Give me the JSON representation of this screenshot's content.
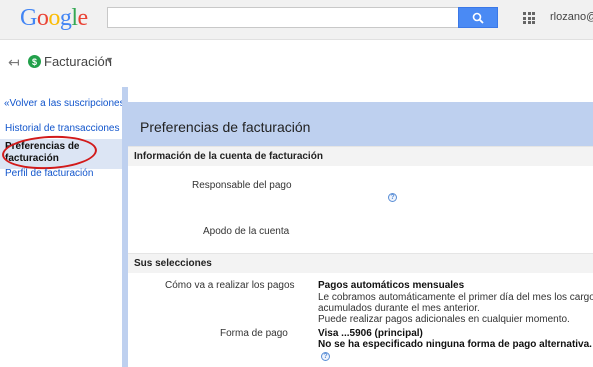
{
  "topbar": {
    "logo_letters": [
      {
        "char": "G",
        "color": "#4285f4"
      },
      {
        "char": "o",
        "color": "#ea4335"
      },
      {
        "char": "o",
        "color": "#fbbc05"
      },
      {
        "char": "g",
        "color": "#4285f4"
      },
      {
        "char": "l",
        "color": "#34a853"
      },
      {
        "char": "e",
        "color": "#ea4335"
      }
    ],
    "search_value": "",
    "user_text": "rlozano@v"
  },
  "subheader": {
    "product_name": "Facturación"
  },
  "sidebar": {
    "back_link": "«Volver a las suscripciones",
    "items": [
      {
        "label": "Historial de transacciones"
      },
      {
        "label": "Preferencias de facturación"
      },
      {
        "label": "Perfil de facturación"
      }
    ]
  },
  "main": {
    "title": "Preferencias de facturación",
    "account_section": {
      "title": "Información de la cuenta de facturación",
      "responsible_label": "Responsable del pago",
      "alias_label": "Apodo de la cuenta"
    },
    "selections_section": {
      "title": "Sus selecciones",
      "payment_method_label": "Cómo va a realizar los pagos",
      "payment_method_value": "Pagos automáticos mensuales",
      "payment_method_desc_1": "Le cobramos automáticamente el primer día del mes los cargos",
      "payment_method_desc_2": "acumulados durante el mes anterior.",
      "payment_method_desc_3": "Puede realizar pagos adicionales en cualquier momento.",
      "payment_form_label": "Forma de pago",
      "payment_form_value": "Visa ...5906 (principal)",
      "payment_form_note": "No se ha especificado ninguna forma de pago alternativa."
    }
  },
  "colors": {
    "accent_band": "#bed0ef",
    "link": "#1155cc",
    "annotation_oval": "#d21a1a",
    "search_button": "#4a8af4"
  }
}
